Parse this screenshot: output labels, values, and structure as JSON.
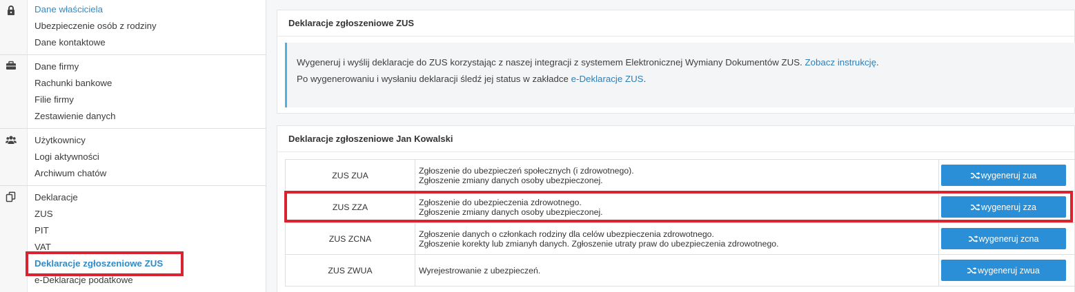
{
  "sidebar": {
    "groups": [
      {
        "icon": "lock-icon",
        "items": [
          "Dane właściciela",
          "Ubezpieczenie osób z rodziny",
          "Dane kontaktowe"
        ]
      },
      {
        "icon": "briefcase-icon",
        "items": [
          "Dane firmy",
          "Rachunki bankowe",
          "Filie firmy",
          "Zestawienie danych"
        ]
      },
      {
        "icon": "users-icon",
        "items": [
          "Użytkownicy",
          "Logi aktywności",
          "Archiwum chatów"
        ]
      },
      {
        "icon": "copy-icon",
        "items": [
          "Deklaracje",
          "ZUS",
          "PIT",
          "VAT",
          "Deklaracje zgłoszeniowe ZUS",
          "e-Deklaracje podatkowe"
        ]
      }
    ],
    "active_item": "Deklaracje zgłoszeniowe ZUS"
  },
  "info_panel": {
    "title": "Deklaracje zgłoszeniowe ZUS",
    "line1_text": "Wygeneruj i wyślij deklaracje do ZUS korzystając z naszej integracji z systemem Elektronicznej Wymiany Dokumentów ZUS. ",
    "line1_link": "Zobacz instrukcję",
    "line1_end": ".",
    "line2_text": "Po wygenerowaniu i wysłaniu deklaracji śledź jej status w zakładce ",
    "line2_link": "e-Deklaracje ZUS",
    "line2_end": "."
  },
  "decl_panel": {
    "title": "Deklaracje zgłoszeniowe Jan Kowalski",
    "rows": [
      {
        "code": "ZUS ZUA",
        "desc1": "Zgłoszenie do ubezpieczeń społecznych (i zdrowotnego).",
        "desc2": "Zgłoszenie zmiany danych osoby ubezpieczonej.",
        "button": "wygeneruj zua"
      },
      {
        "code": "ZUS ZZA",
        "desc1": "Zgłoszenie do ubezpieczenia zdrowotnego.",
        "desc2": "Zgłoszenie zmiany danych osoby ubezpieczonej.",
        "button": "wygeneruj zza"
      },
      {
        "code": "ZUS ZCNA",
        "desc1": "Zgłoszenie danych o członkach rodziny dla celów ubezpieczenia zdrowotnego.",
        "desc2": "Zgłoszenie korekty lub zmianyh danych. Zgłoszenie utraty praw do ubezpieczenia zdrowotnego.",
        "button": "wygeneruj zcna"
      },
      {
        "code": "ZUS ZWUA",
        "desc1": "Wyrejestrowanie z ubezpieczeń.",
        "desc2": "",
        "button": "wygeneruj zwua"
      }
    ]
  },
  "colors": {
    "accent_blue": "#2a8fd6",
    "link_blue": "#2e7fb8",
    "highlight_red": "#d9232f",
    "info_border": "#4fb3dd"
  }
}
